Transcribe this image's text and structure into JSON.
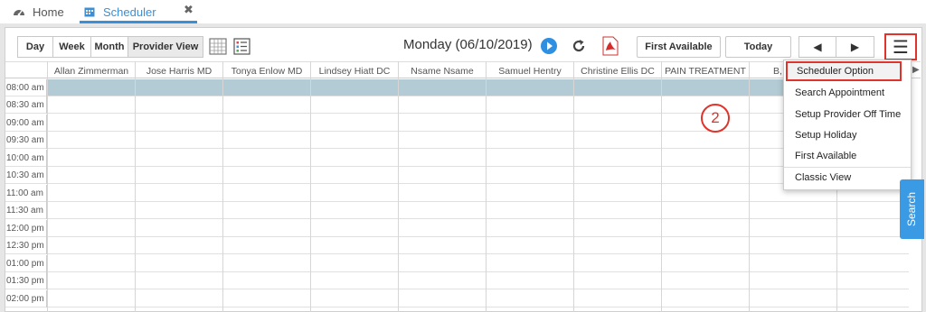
{
  "tabs": {
    "home_label": "Home",
    "scheduler_label": "Scheduler",
    "close_glyph": "✖"
  },
  "toolbar": {
    "view_buttons": [
      "Day",
      "Week",
      "Month",
      "Provider View"
    ],
    "active_view": "Provider View",
    "date_title": "Monday (06/10/2019)",
    "first_available_label": "First Available",
    "today_label": "Today",
    "prev_glyph": "◀",
    "next_glyph": "▶",
    "menu_glyph": "☰"
  },
  "grid": {
    "providers": [
      "Allan Zimmerman",
      "Jose Harris MD",
      "Tonya Enlow MD",
      "Lindsey Hiatt DC",
      "Nsame Nsame",
      "Samuel Hentry",
      "Christine Ellis DC",
      "PAIN TREATMENT",
      "B, I"
    ],
    "times": [
      "08:00 am",
      "08:30 am",
      "09:00 am",
      "09:30 am",
      "10:00 am",
      "10:30 am",
      "11:00 am",
      "11:30 am",
      "12:00 pm",
      "12:30 pm",
      "01:00 pm",
      "01:30 pm",
      "02:00 pm"
    ]
  },
  "menu": {
    "items": [
      "Scheduler Option",
      "Search Appointment",
      "Setup Provider Off Time",
      "Setup Holiday",
      "First Available",
      "Classic View"
    ],
    "highlighted": "Scheduler Option"
  },
  "annotation": {
    "step_number": "2"
  },
  "search_tab_label": "Search",
  "colors": {
    "accent": "#3a8fd6",
    "highlight_row": "#b3cbd4",
    "annotation_red": "#e0332b",
    "search_tab": "#3a9be4"
  }
}
